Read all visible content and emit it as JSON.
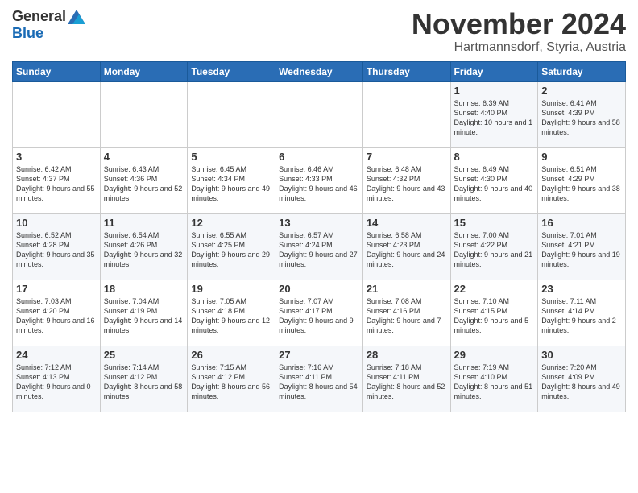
{
  "logo": {
    "general": "General",
    "blue": "Blue"
  },
  "title": "November 2024",
  "location": "Hartmannsdorf, Styria, Austria",
  "headers": [
    "Sunday",
    "Monday",
    "Tuesday",
    "Wednesday",
    "Thursday",
    "Friday",
    "Saturday"
  ],
  "weeks": [
    [
      {
        "day": "",
        "info": ""
      },
      {
        "day": "",
        "info": ""
      },
      {
        "day": "",
        "info": ""
      },
      {
        "day": "",
        "info": ""
      },
      {
        "day": "",
        "info": ""
      },
      {
        "day": "1",
        "info": "Sunrise: 6:39 AM\nSunset: 4:40 PM\nDaylight: 10 hours and 1 minute."
      },
      {
        "day": "2",
        "info": "Sunrise: 6:41 AM\nSunset: 4:39 PM\nDaylight: 9 hours and 58 minutes."
      }
    ],
    [
      {
        "day": "3",
        "info": "Sunrise: 6:42 AM\nSunset: 4:37 PM\nDaylight: 9 hours and 55 minutes."
      },
      {
        "day": "4",
        "info": "Sunrise: 6:43 AM\nSunset: 4:36 PM\nDaylight: 9 hours and 52 minutes."
      },
      {
        "day": "5",
        "info": "Sunrise: 6:45 AM\nSunset: 4:34 PM\nDaylight: 9 hours and 49 minutes."
      },
      {
        "day": "6",
        "info": "Sunrise: 6:46 AM\nSunset: 4:33 PM\nDaylight: 9 hours and 46 minutes."
      },
      {
        "day": "7",
        "info": "Sunrise: 6:48 AM\nSunset: 4:32 PM\nDaylight: 9 hours and 43 minutes."
      },
      {
        "day": "8",
        "info": "Sunrise: 6:49 AM\nSunset: 4:30 PM\nDaylight: 9 hours and 40 minutes."
      },
      {
        "day": "9",
        "info": "Sunrise: 6:51 AM\nSunset: 4:29 PM\nDaylight: 9 hours and 38 minutes."
      }
    ],
    [
      {
        "day": "10",
        "info": "Sunrise: 6:52 AM\nSunset: 4:28 PM\nDaylight: 9 hours and 35 minutes."
      },
      {
        "day": "11",
        "info": "Sunrise: 6:54 AM\nSunset: 4:26 PM\nDaylight: 9 hours and 32 minutes."
      },
      {
        "day": "12",
        "info": "Sunrise: 6:55 AM\nSunset: 4:25 PM\nDaylight: 9 hours and 29 minutes."
      },
      {
        "day": "13",
        "info": "Sunrise: 6:57 AM\nSunset: 4:24 PM\nDaylight: 9 hours and 27 minutes."
      },
      {
        "day": "14",
        "info": "Sunrise: 6:58 AM\nSunset: 4:23 PM\nDaylight: 9 hours and 24 minutes."
      },
      {
        "day": "15",
        "info": "Sunrise: 7:00 AM\nSunset: 4:22 PM\nDaylight: 9 hours and 21 minutes."
      },
      {
        "day": "16",
        "info": "Sunrise: 7:01 AM\nSunset: 4:21 PM\nDaylight: 9 hours and 19 minutes."
      }
    ],
    [
      {
        "day": "17",
        "info": "Sunrise: 7:03 AM\nSunset: 4:20 PM\nDaylight: 9 hours and 16 minutes."
      },
      {
        "day": "18",
        "info": "Sunrise: 7:04 AM\nSunset: 4:19 PM\nDaylight: 9 hours and 14 minutes."
      },
      {
        "day": "19",
        "info": "Sunrise: 7:05 AM\nSunset: 4:18 PM\nDaylight: 9 hours and 12 minutes."
      },
      {
        "day": "20",
        "info": "Sunrise: 7:07 AM\nSunset: 4:17 PM\nDaylight: 9 hours and 9 minutes."
      },
      {
        "day": "21",
        "info": "Sunrise: 7:08 AM\nSunset: 4:16 PM\nDaylight: 9 hours and 7 minutes."
      },
      {
        "day": "22",
        "info": "Sunrise: 7:10 AM\nSunset: 4:15 PM\nDaylight: 9 hours and 5 minutes."
      },
      {
        "day": "23",
        "info": "Sunrise: 7:11 AM\nSunset: 4:14 PM\nDaylight: 9 hours and 2 minutes."
      }
    ],
    [
      {
        "day": "24",
        "info": "Sunrise: 7:12 AM\nSunset: 4:13 PM\nDaylight: 9 hours and 0 minutes."
      },
      {
        "day": "25",
        "info": "Sunrise: 7:14 AM\nSunset: 4:12 PM\nDaylight: 8 hours and 58 minutes."
      },
      {
        "day": "26",
        "info": "Sunrise: 7:15 AM\nSunset: 4:12 PM\nDaylight: 8 hours and 56 minutes."
      },
      {
        "day": "27",
        "info": "Sunrise: 7:16 AM\nSunset: 4:11 PM\nDaylight: 8 hours and 54 minutes."
      },
      {
        "day": "28",
        "info": "Sunrise: 7:18 AM\nSunset: 4:11 PM\nDaylight: 8 hours and 52 minutes."
      },
      {
        "day": "29",
        "info": "Sunrise: 7:19 AM\nSunset: 4:10 PM\nDaylight: 8 hours and 51 minutes."
      },
      {
        "day": "30",
        "info": "Sunrise: 7:20 AM\nSunset: 4:09 PM\nDaylight: 8 hours and 49 minutes."
      }
    ]
  ]
}
